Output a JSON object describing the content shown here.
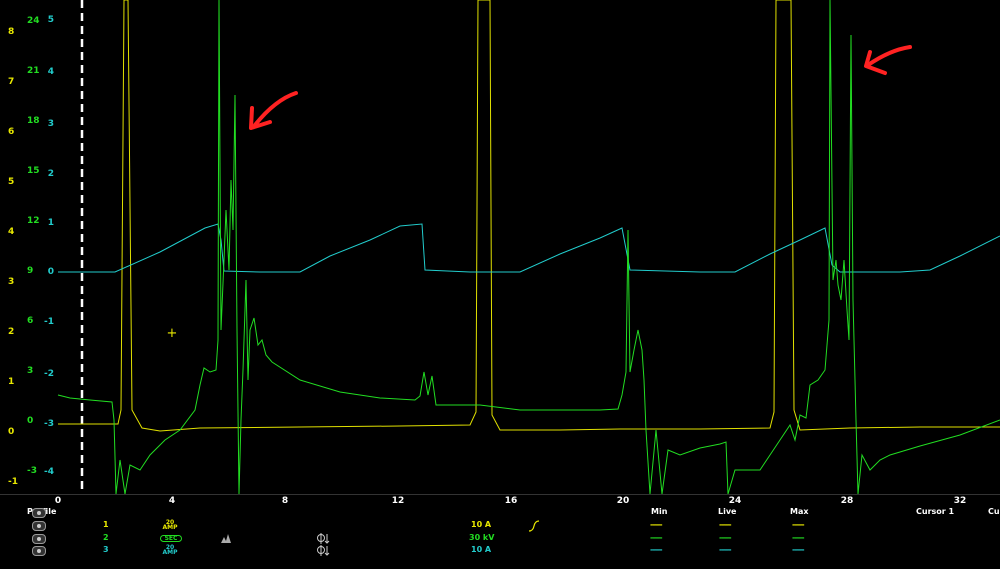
{
  "scope": {
    "axis_yellow": {
      "color": "#e8e800",
      "labels": [
        "8",
        "7",
        "6",
        "5",
        "4",
        "3",
        "2",
        "1",
        "0"
      ]
    },
    "axis_green": {
      "color": "#22dd22",
      "labels": [
        "24",
        "21",
        "18",
        "15",
        "12",
        "9",
        "6",
        "3",
        "0",
        "-3"
      ]
    },
    "axis_cyan": {
      "color": "#22cccc",
      "labels": [
        "5",
        "4",
        "3",
        "2",
        "1",
        "0",
        "-1",
        "-2",
        "-3",
        "-4"
      ]
    },
    "axis_leftmost": [
      "-1"
    ],
    "x_ticks": [
      "0",
      "4",
      "8",
      "12",
      "16",
      "20",
      "24",
      "28",
      "32"
    ],
    "annotation_color": "#ff2222",
    "cursor_glyph": "+"
  },
  "panel": {
    "headers": {
      "profile": "Profile",
      "min": "Min",
      "live": "Live",
      "max": "Max",
      "cursor1": "Cursor 1",
      "cursor2": "Cu"
    },
    "channels": [
      {
        "num": "1",
        "color": "#e8e800",
        "probe": "20 AMP",
        "scale": "10 A",
        "min": "-----",
        "live": "-----",
        "max": "-----"
      },
      {
        "num": "2",
        "color": "#22dd22",
        "probe": "SEC",
        "scale": "30 kV",
        "min": "-----",
        "live": "-----",
        "max": "-----"
      },
      {
        "num": "3",
        "color": "#22cccc",
        "probe": "20 AMP",
        "scale": "10 A",
        "min": "-----",
        "live": "-----",
        "max": "-----"
      }
    ]
  }
}
